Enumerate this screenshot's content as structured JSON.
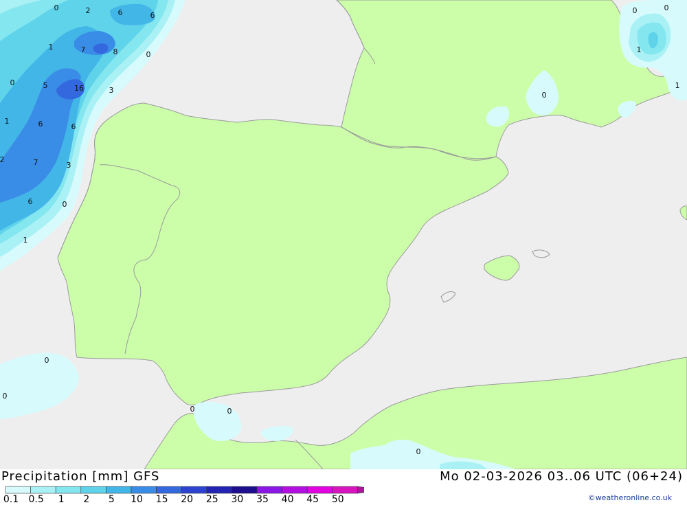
{
  "header": {
    "title": "Precipitation [mm] GFS",
    "datetime": "Mo 02-03-2026 03..06 UTC (06+24)",
    "credit": "©weatheronline.co.uk"
  },
  "legend": {
    "labels": [
      "0.1",
      "0.5",
      "1",
      "2",
      "5",
      "10",
      "15",
      "20",
      "25",
      "30",
      "35",
      "40",
      "45",
      "50"
    ],
    "colors": [
      "#d7fbfd",
      "#aaf1f5",
      "#84e6ef",
      "#5fd3ea",
      "#43b6e8",
      "#3a8de6",
      "#3468de",
      "#2c43cf",
      "#2424b3",
      "#1d0f8d",
      "#8a17e6",
      "#b20fe0",
      "#e104e0",
      "#d714bd",
      "#a8199a"
    ]
  },
  "colors": {
    "sea": "#eeeeee",
    "land": "#ccfeaa",
    "border": "#9a9a9a"
  },
  "map_labels": [
    "0",
    "2",
    "6",
    "6",
    "1",
    "7",
    "8",
    "0",
    "0",
    "5",
    "16",
    "3",
    "1",
    "6",
    "6",
    "2",
    "7",
    "3",
    "6",
    "0",
    "1",
    "0",
    "0",
    "0",
    "0",
    "0",
    "0",
    "1",
    "0",
    "1"
  ]
}
